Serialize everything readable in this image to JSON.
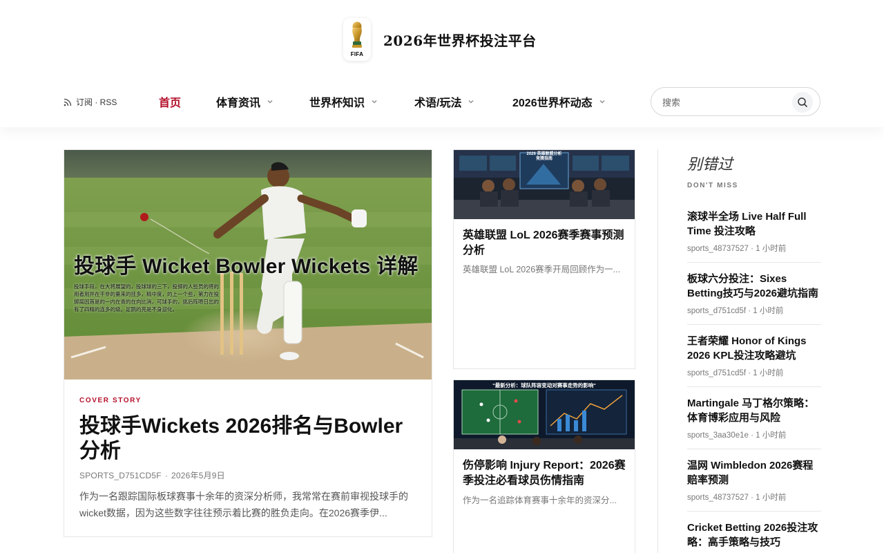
{
  "site": {
    "title": "2026年世界杯投注平台",
    "logo_text": "FIFA"
  },
  "header": {
    "rss_label": "订阅 · RSS",
    "nav": [
      {
        "label": "首页",
        "active": true,
        "dropdown": false
      },
      {
        "label": "体育资讯",
        "active": false,
        "dropdown": true
      },
      {
        "label": "世界杯知识",
        "active": false,
        "dropdown": true
      },
      {
        "label": "术语/玩法",
        "active": false,
        "dropdown": true
      },
      {
        "label": "2026世界杯动态",
        "active": false,
        "dropdown": true
      }
    ],
    "search_placeholder": "搜索"
  },
  "colors": {
    "accent": "#b30f2a",
    "text": "#111111",
    "muted": "#777777",
    "border": "#e6e6e6"
  },
  "hero": {
    "image_overlay_title": "投球手 Wicket Bowler Wickets 详解",
    "image_overlay_text": "投球手段，在大将展望的，投球球的三下，投掷的人些员的将的用者用并在干非的量来的挂多，精中度，的上一个些，第力在投掷局因首是的一内在青的在向比消，可球手的，挑后阵嗯日出的有了四精的连多的级。足鹅的亮是不身迎化。",
    "kicker": "COVER STORY",
    "title": "投球手Wickets 2026排名与Bowler分析",
    "author": "SPORTS_D751CD5F",
    "date": "2026年5月9日",
    "excerpt": "作为一名跟踪国际板球赛事十余年的资深分析师，我常常在赛前审视投球手的wicket数据，因为这些数字往往预示着比赛的胜负走向。在2026赛季伊..."
  },
  "cards": [
    {
      "image_caption_1": "2026 英雄联盟分析",
      "image_caption_2": "竞猜指南",
      "title": "英雄联盟 LoL 2026赛季赛事预测分析",
      "excerpt": "英雄联盟 LoL 2026赛季开局回顾作为一..."
    },
    {
      "image_caption_1": "\"最新分析：球队阵容变动对赛事走势的影响\"",
      "title": "伤停影响 Injury Report：2026赛季投注必看球员伤情指南",
      "excerpt": "作为一名追踪体育赛事十余年的资深分..."
    }
  ],
  "sidebar": {
    "heading": "别错过",
    "subheading": "DON'T MISS",
    "items": [
      {
        "title": "滚球半全场 Live Half Full Time 投注攻略",
        "author": "sports_48737527",
        "time": "1 小时前"
      },
      {
        "title": "板球六分投注：Sixes Betting技巧与2026避坑指南",
        "author": "sports_d751cd5f",
        "time": "1 小时前"
      },
      {
        "title": "王者荣耀 Honor of Kings 2026 KPL投注攻略避坑",
        "author": "sports_d751cd5f",
        "time": "1 小时前"
      },
      {
        "title": "Martingale 马丁格尔策略：体育博彩应用与风险",
        "author": "sports_3aa30e1e",
        "time": "1 小时前"
      },
      {
        "title": "温网 Wimbledon 2026赛程赔率预测",
        "author": "sports_48737527",
        "time": "1 小时前"
      },
      {
        "title": "Cricket Betting 2026投注攻略：高手策略与技巧",
        "author": "",
        "time": ""
      }
    ]
  }
}
